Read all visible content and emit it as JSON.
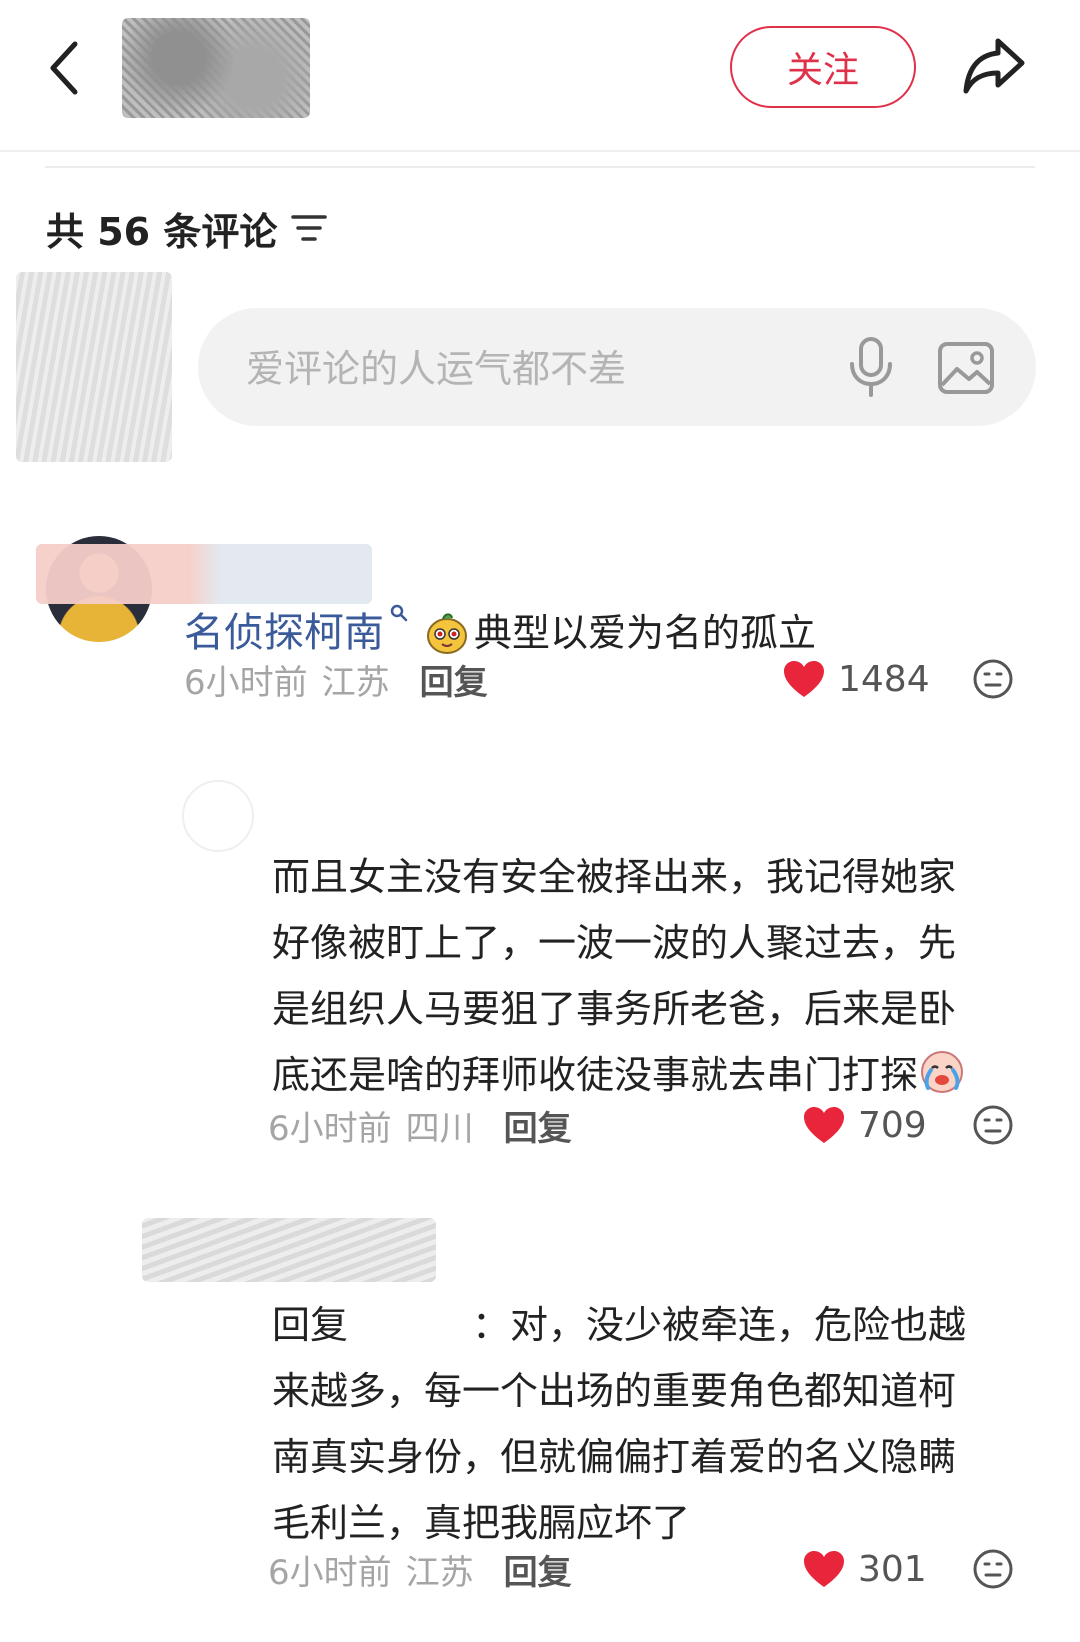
{
  "header": {
    "follow_label": "关注"
  },
  "comments_header": {
    "count_label": "共 56 条评论"
  },
  "composer": {
    "placeholder": "爱评论的人运气都不差"
  },
  "comments": [
    {
      "tag_name": "名侦探柯南",
      "text": "典型以爱为名的孤立",
      "time": "6小时前",
      "location": "江苏",
      "reply_label": "回复",
      "likes": "1484",
      "replies": [
        {
          "lines": [
            "而且女主没有安全被择出来，我记得她家",
            "好像被盯上了，一波一波的人聚过去，先",
            "是组织人马要狙了事务所老爸，后来是卧",
            "底还是啥的拜师收徒没事就去串门打探"
          ],
          "time": "6小时前",
          "location": "四川",
          "reply_label": "回复",
          "likes": "709"
        },
        {
          "prefix": "回复",
          "separator": "：",
          "first_line_rest": "对，没少被牵连，危险也越",
          "lines": [
            "来越多，每一个出场的重要角色都知道柯",
            "南真实身份，但就偏偏打着爱的名义隐瞒",
            "毛利兰，真把我膈应坏了"
          ],
          "time": "6小时前",
          "location": "江苏",
          "reply_label": "回复",
          "likes": "301"
        }
      ]
    }
  ],
  "icons": {
    "back": "chevron-left-icon",
    "share": "share-icon",
    "sort": "sort-icon",
    "mic": "microphone-icon",
    "image": "image-icon",
    "like": "heart-icon",
    "emoji": "emoji-icon"
  },
  "colors": {
    "accent": "#e0314a",
    "like": "#e8253b",
    "tag": "#3a5a9a",
    "muted": "#a5a5a5"
  }
}
